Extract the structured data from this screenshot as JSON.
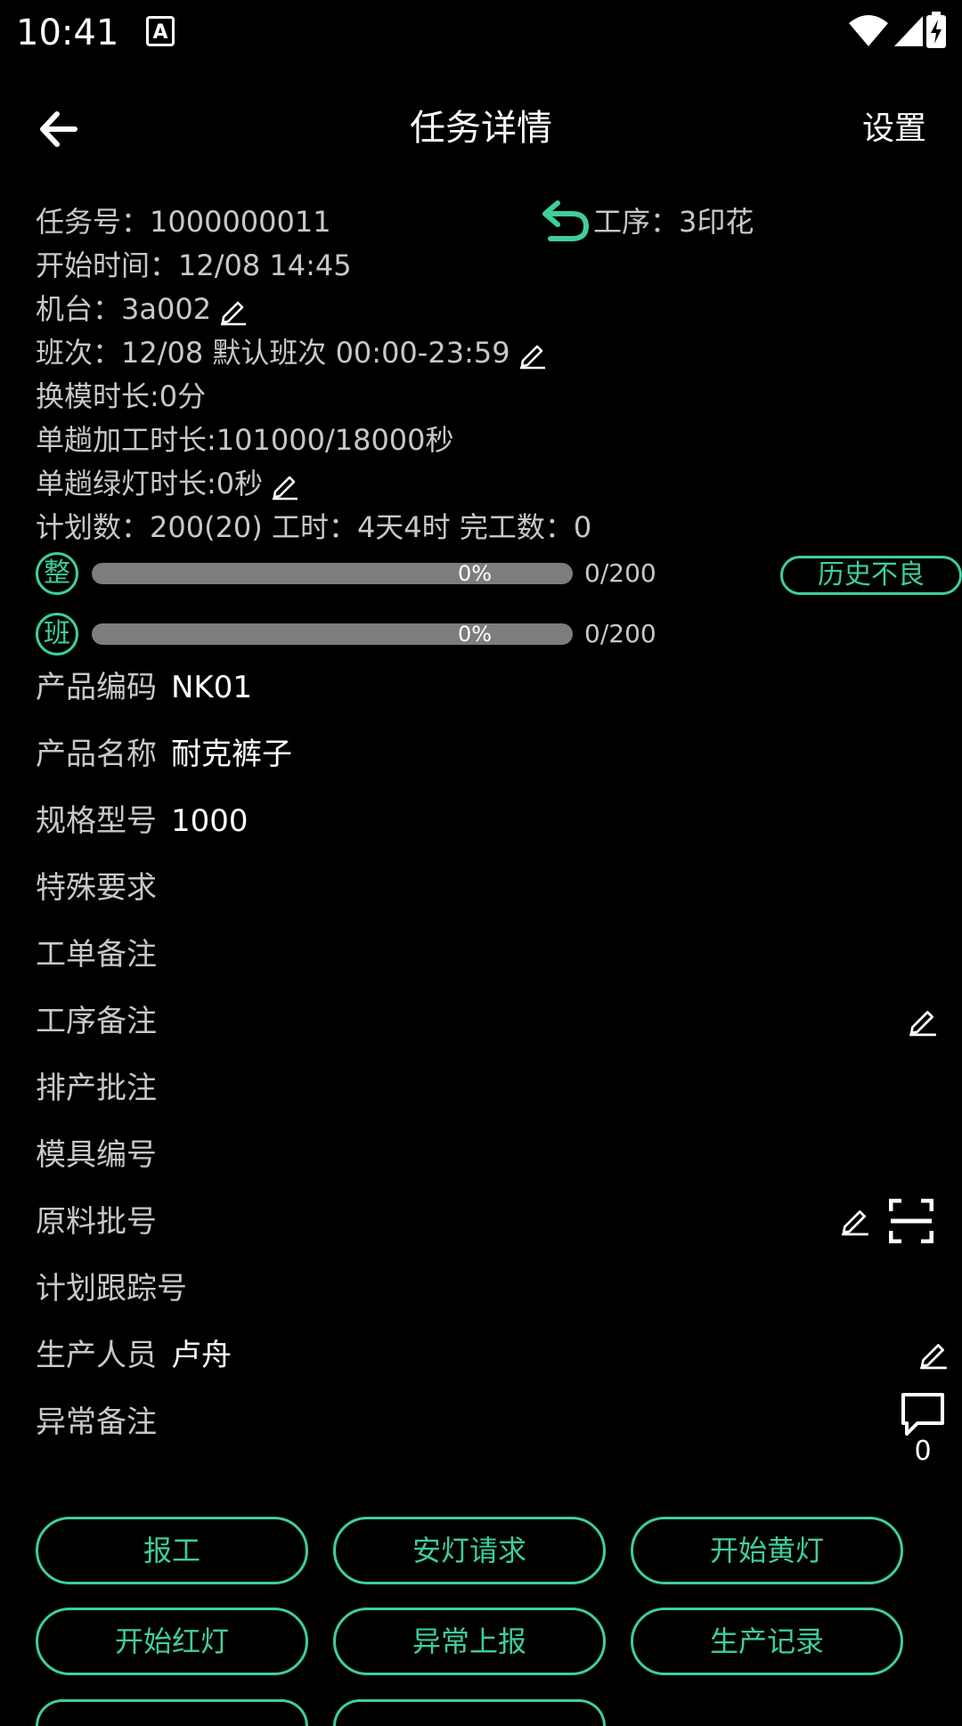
{
  "status": {
    "time": "10:41",
    "a_badge": "A"
  },
  "toolbar": {
    "title": "任务详情",
    "settings": "设置"
  },
  "info": {
    "task_no": "任务号：1000000011",
    "process": "工序：3印花",
    "start_time": "开始时间：12/08 14:45",
    "machine": "机台：3a002",
    "shift": "班次：12/08 默认班次 00:00-23:59",
    "mold_change": "换模时长:0分",
    "single_time": "单趟加工时长:101000/18000秒",
    "green_time": "单趟绿灯时长:0秒",
    "plan_line": "计划数：200(20)  工时：4天4时  完工数：0"
  },
  "progress": [
    {
      "badge": "整",
      "percent": "0%",
      "count": "0/200",
      "fraction": 0
    },
    {
      "badge": "班",
      "percent": "0%",
      "count": "0/200",
      "fraction": 0
    }
  ],
  "history_bad": "历史不良",
  "fields": [
    {
      "label": "产品编码",
      "value": "NK01"
    },
    {
      "label": "产品名称",
      "value": "耐克裤子"
    },
    {
      "label": "规格型号",
      "value": "1000"
    },
    {
      "label": "特殊要求",
      "value": ""
    },
    {
      "label": "工单备注",
      "value": ""
    },
    {
      "label": "工序备注",
      "value": ""
    },
    {
      "label": "排产批注",
      "value": ""
    },
    {
      "label": "模具编号",
      "value": ""
    },
    {
      "label": "原料批号",
      "value": ""
    },
    {
      "label": "计划跟踪号",
      "value": ""
    },
    {
      "label": "生产人员",
      "value": "卢舟"
    },
    {
      "label": "异常备注",
      "value": ""
    }
  ],
  "comment_count": "0",
  "buttons": [
    "报工",
    "安灯请求",
    "开始黄灯",
    "开始红灯",
    "异常上报",
    "生产记录"
  ],
  "colors": {
    "accent": "#3ecf9a",
    "background": "#000000",
    "bar": "#7d7d7d"
  }
}
